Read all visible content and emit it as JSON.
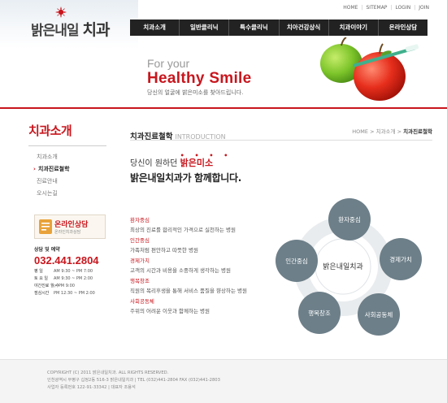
{
  "util_links": [
    "HOME",
    "SITEMAP",
    "LOGIN",
    "JOIN"
  ],
  "logo": {
    "text_a": "밝은내일",
    "text_b": "치과"
  },
  "gnb": [
    "치과소개",
    "일반클리닉",
    "특수클리닉",
    "치아건강상식",
    "치과이야기",
    "온라인상담"
  ],
  "hero": {
    "for_your": "For your",
    "title": "Healthy Smile",
    "sub": "당신의 얼굴에 밝은미소를 찾아드립니다."
  },
  "lnb": {
    "title": "치과소개",
    "items": [
      "치과소개",
      "치과진료철학",
      "진료안내",
      "오시는길"
    ],
    "active_index": 1
  },
  "consult": {
    "title": "온라인상담",
    "sub": "온라인치과상담"
  },
  "phone": {
    "label": "상담 및 예약",
    "number": "032.441.2804",
    "hours": [
      {
        "day": "평 일",
        "time": "AM 9:30 ~ PM 7:00"
      },
      {
        "day": "토 요 일",
        "time": "AM 9:30 ~ PM 2:00"
      },
      {
        "day": "야간진료 월,수",
        "time": "~ PM 9:00"
      },
      {
        "day": "점심시간",
        "time": "PM 12:30 ~ PM 2:00"
      }
    ]
  },
  "content": {
    "title_ko": "치과진료철학",
    "title_en": "INTRODUCTION",
    "breadcrumb": [
      "HOME",
      "치과소개",
      "치과진료철학"
    ],
    "slogan_pre": "당신이 원하던",
    "slogan_em": "밝은미소",
    "slogan_dots": "• • • •",
    "slogan2": "밝은내일치과가 함께합니다."
  },
  "values": [
    {
      "head": "환자중심",
      "desc": "최상의 진료를 합리적인 가격으로 실천하는 병원"
    },
    {
      "head": "인간중심",
      "desc": "가족처럼 편안하고 따뜻한 병원"
    },
    {
      "head": "경제가치",
      "desc": "고객의 시간과 비용을 소중하게 생각하는 병원"
    },
    {
      "head": "행복창조",
      "desc": "직원의 복리후생을 통해 서비스 품질을 향상하는 병원"
    },
    {
      "head": "사회공동체",
      "desc": "주위의 어려운 이웃과 함께하는 병원"
    }
  ],
  "diagram": {
    "center": "밝은내일치과",
    "nodes": [
      "환자중심",
      "경제가치",
      "사회공동체",
      "행복창조",
      "인간중심"
    ]
  },
  "footer": [
    "COPYRIGHT (C) 2011 밝은내일치과. ALL RIGHTS RESERVED.",
    "인천광역시 부평구 십정2동 516-3 밝은내일치과  |  TEL (032)441-2804   FAX (032)441-2803",
    "사업자 등록번호 122-91-33342  |  대표자 조용석"
  ],
  "colors": {
    "brand_red": "#c8161d",
    "nav_dark": "#222222",
    "circle": "#6d7f89"
  }
}
